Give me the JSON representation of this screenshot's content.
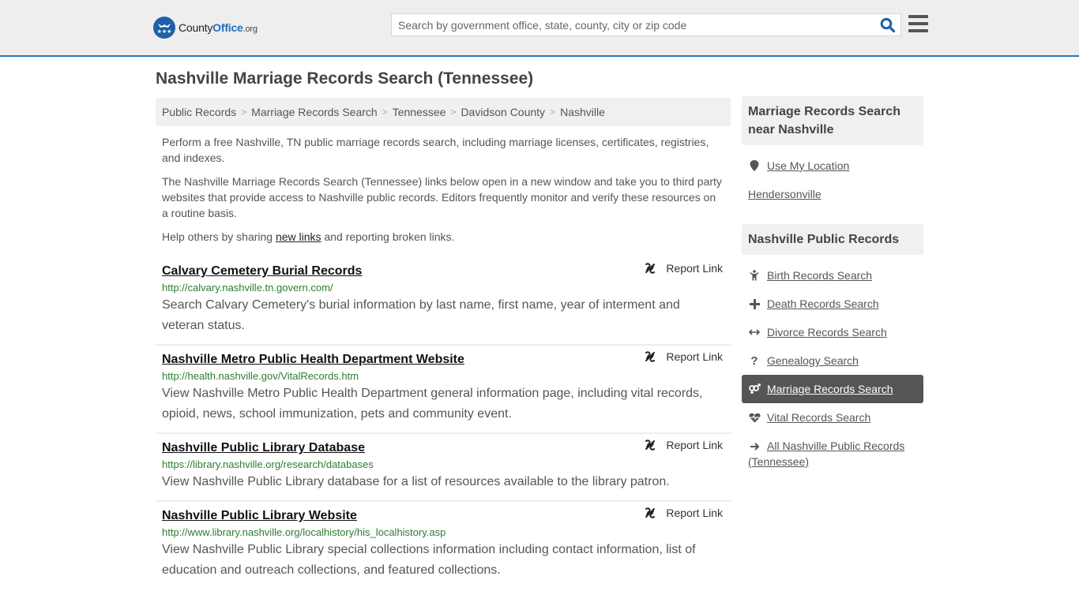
{
  "header": {
    "logo": {
      "name_part1": "County",
      "name_part2": "Office",
      "suffix": ".org"
    },
    "search": {
      "placeholder": "Search by government office, state, county, city or zip code",
      "value": ""
    },
    "accent_color": "#2b75b3"
  },
  "page_title": "Nashville Marriage Records Search (Tennessee)",
  "breadcrumb": [
    {
      "label": "Public Records"
    },
    {
      "label": "Marriage Records Search"
    },
    {
      "label": "Tennessee"
    },
    {
      "label": "Davidson County"
    },
    {
      "label": "Nashville"
    }
  ],
  "intro": {
    "p1": "Perform a free Nashville, TN public marriage records search, including marriage licenses, certificates, registries, and indexes.",
    "p2": "The Nashville Marriage Records Search (Tennessee) links below open in a new window and take you to third party websites that provide access to Nashville public records. Editors frequently monitor and verify these resources on a routine basis.",
    "p3_before": "Help others by sharing ",
    "p3_link": "new links",
    "p3_after": " and reporting broken links."
  },
  "listings": [
    {
      "title": "Calvary Cemetery Burial Records",
      "url": "http://calvary.nashville.tn.govern.com/",
      "description": "Search Calvary Cemetery's burial information by last name, first name, year of interment and veteran status.",
      "report_label": "Report Link"
    },
    {
      "title": "Nashville Metro Public Health Department Website",
      "url": "http://health.nashville.gov/VitalRecords.htm",
      "description": "View Nashville Metro Public Health Department general information page, including vital records, opioid, news, school immunization, pets and community event.",
      "report_label": "Report Link"
    },
    {
      "title": "Nashville Public Library Database",
      "url": "https://library.nashville.org/research/databases",
      "description": "View Nashville Public Library database for a list of resources available to the library patron.",
      "report_label": "Report Link"
    },
    {
      "title": "Nashville Public Library Website",
      "url": "http://www.library.nashville.org/localhistory/his_localhistory.asp",
      "description": "View Nashville Public Library special collections information including contact information, list of education and outreach collections, and featured collections.",
      "report_label": "Report Link"
    }
  ],
  "sidebar": {
    "nearby": {
      "heading": "Marriage Records Search near Nashville",
      "use_location": "Use My Location",
      "cities": [
        "Hendersonville"
      ]
    },
    "public_records": {
      "heading": "Nashville Public Records",
      "items": [
        {
          "label": "Birth Records Search",
          "icon": "child-icon",
          "active": false
        },
        {
          "label": "Death Records Search",
          "icon": "plus-icon",
          "active": false
        },
        {
          "label": "Divorce Records Search",
          "icon": "arrows-horizontal-icon",
          "active": false
        },
        {
          "label": "Genealogy Search",
          "icon": "question-icon",
          "active": false
        },
        {
          "label": "Marriage Records Search",
          "icon": "venus-mars-icon",
          "active": true
        },
        {
          "label": "Vital Records Search",
          "icon": "heartbeat-icon",
          "active": false
        },
        {
          "label": "All Nashville Public Records (Tennessee)",
          "icon": "arrow-right-icon",
          "active": false
        }
      ]
    }
  }
}
